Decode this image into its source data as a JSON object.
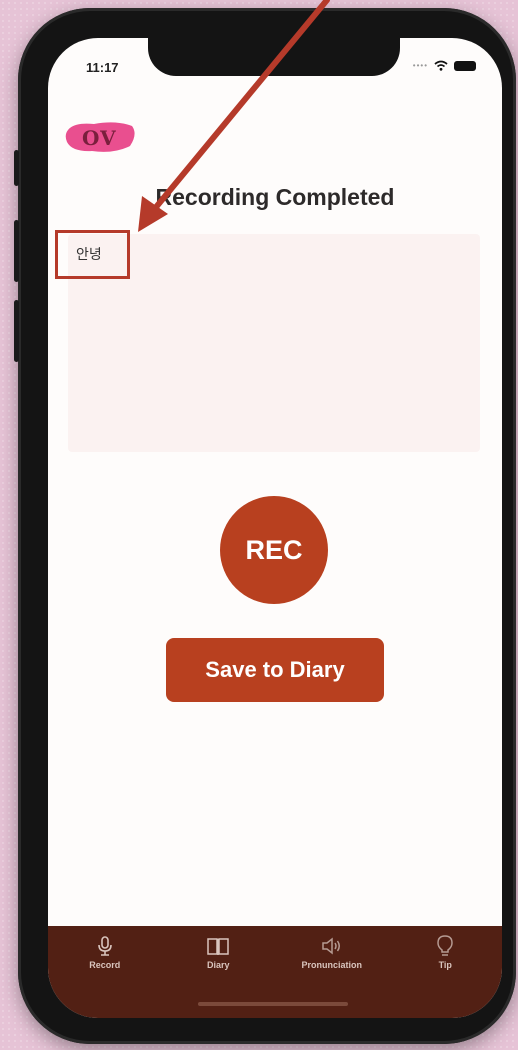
{
  "status": {
    "time": "11:17"
  },
  "logo": {
    "text": "OV"
  },
  "title": "Recording Completed",
  "transcript": {
    "text": "안녕"
  },
  "buttons": {
    "rec_label": "REC",
    "save_label": "Save to Diary"
  },
  "tabs": [
    {
      "label": "Record",
      "icon": "mic-icon"
    },
    {
      "label": "Diary",
      "icon": "book-icon"
    },
    {
      "label": "Pronunciation",
      "icon": "speaker-icon"
    },
    {
      "label": "Tip",
      "icon": "lightbulb-icon"
    }
  ],
  "colors": {
    "accent": "#b8401f",
    "tabbar": "#522014",
    "annotation": "#b53a2a",
    "logo_blob": "#e94f8f",
    "background": "#e6c3d6"
  }
}
